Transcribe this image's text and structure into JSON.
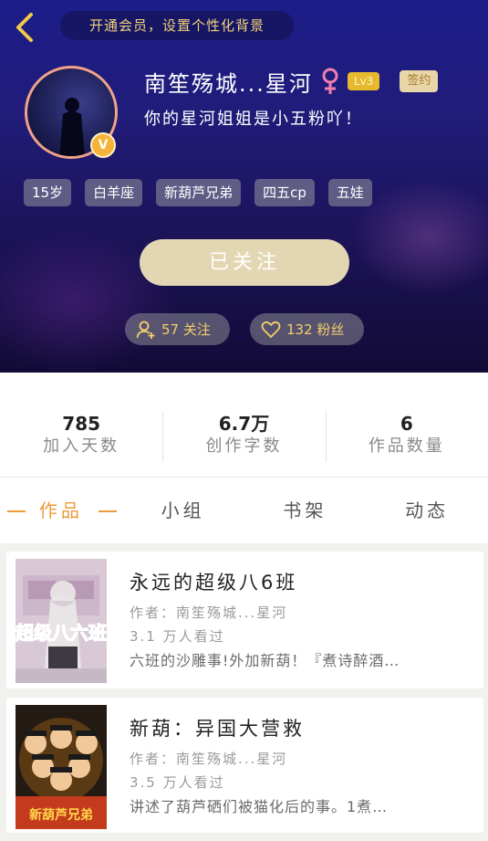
{
  "header": {
    "vip_banner": "开通会员，设置个性化背景",
    "username": "南笙殇城...星河",
    "level": "Lv3",
    "sign_badge": "签约",
    "bio": "你的星河姐姐是小五粉吖！",
    "tags": [
      "15岁",
      "白羊座",
      "新葫芦兄弟",
      "四五cp",
      "五娃"
    ],
    "follow_button": "已关注",
    "following": "57 关注",
    "fans": "132 粉丝",
    "avatar_badge": "V",
    "colors": {
      "accent": "#f3cf6c",
      "follow_button_bg": "#e3d7b3",
      "level_badge": "#e8b82d"
    }
  },
  "stats": [
    {
      "value": "785",
      "label": "加入天数"
    },
    {
      "value": "6.7万",
      "label": "创作字数"
    },
    {
      "value": "6",
      "label": "作品数量"
    }
  ],
  "tabs": [
    {
      "label": "作品",
      "active": true
    },
    {
      "label": "小组",
      "active": false
    },
    {
      "label": "书架",
      "active": false
    },
    {
      "label": "动态",
      "active": false
    }
  ],
  "works": [
    {
      "title": "永远的超级八6班",
      "author": "作者：南笙殇城...星河",
      "views": "3.1 万人看过",
      "desc": "六班的沙雕事!外加新葫！『煮诗醉酒…",
      "cover_text": "超级八六班"
    },
    {
      "title": "新葫：异国大营救",
      "author": "作者：南笙殇城...星河",
      "views": "3.5 万人看过",
      "desc": "讲述了葫芦硒们被猫化后的事。1煮…",
      "cover_text": "新葫芦兄弟"
    }
  ]
}
